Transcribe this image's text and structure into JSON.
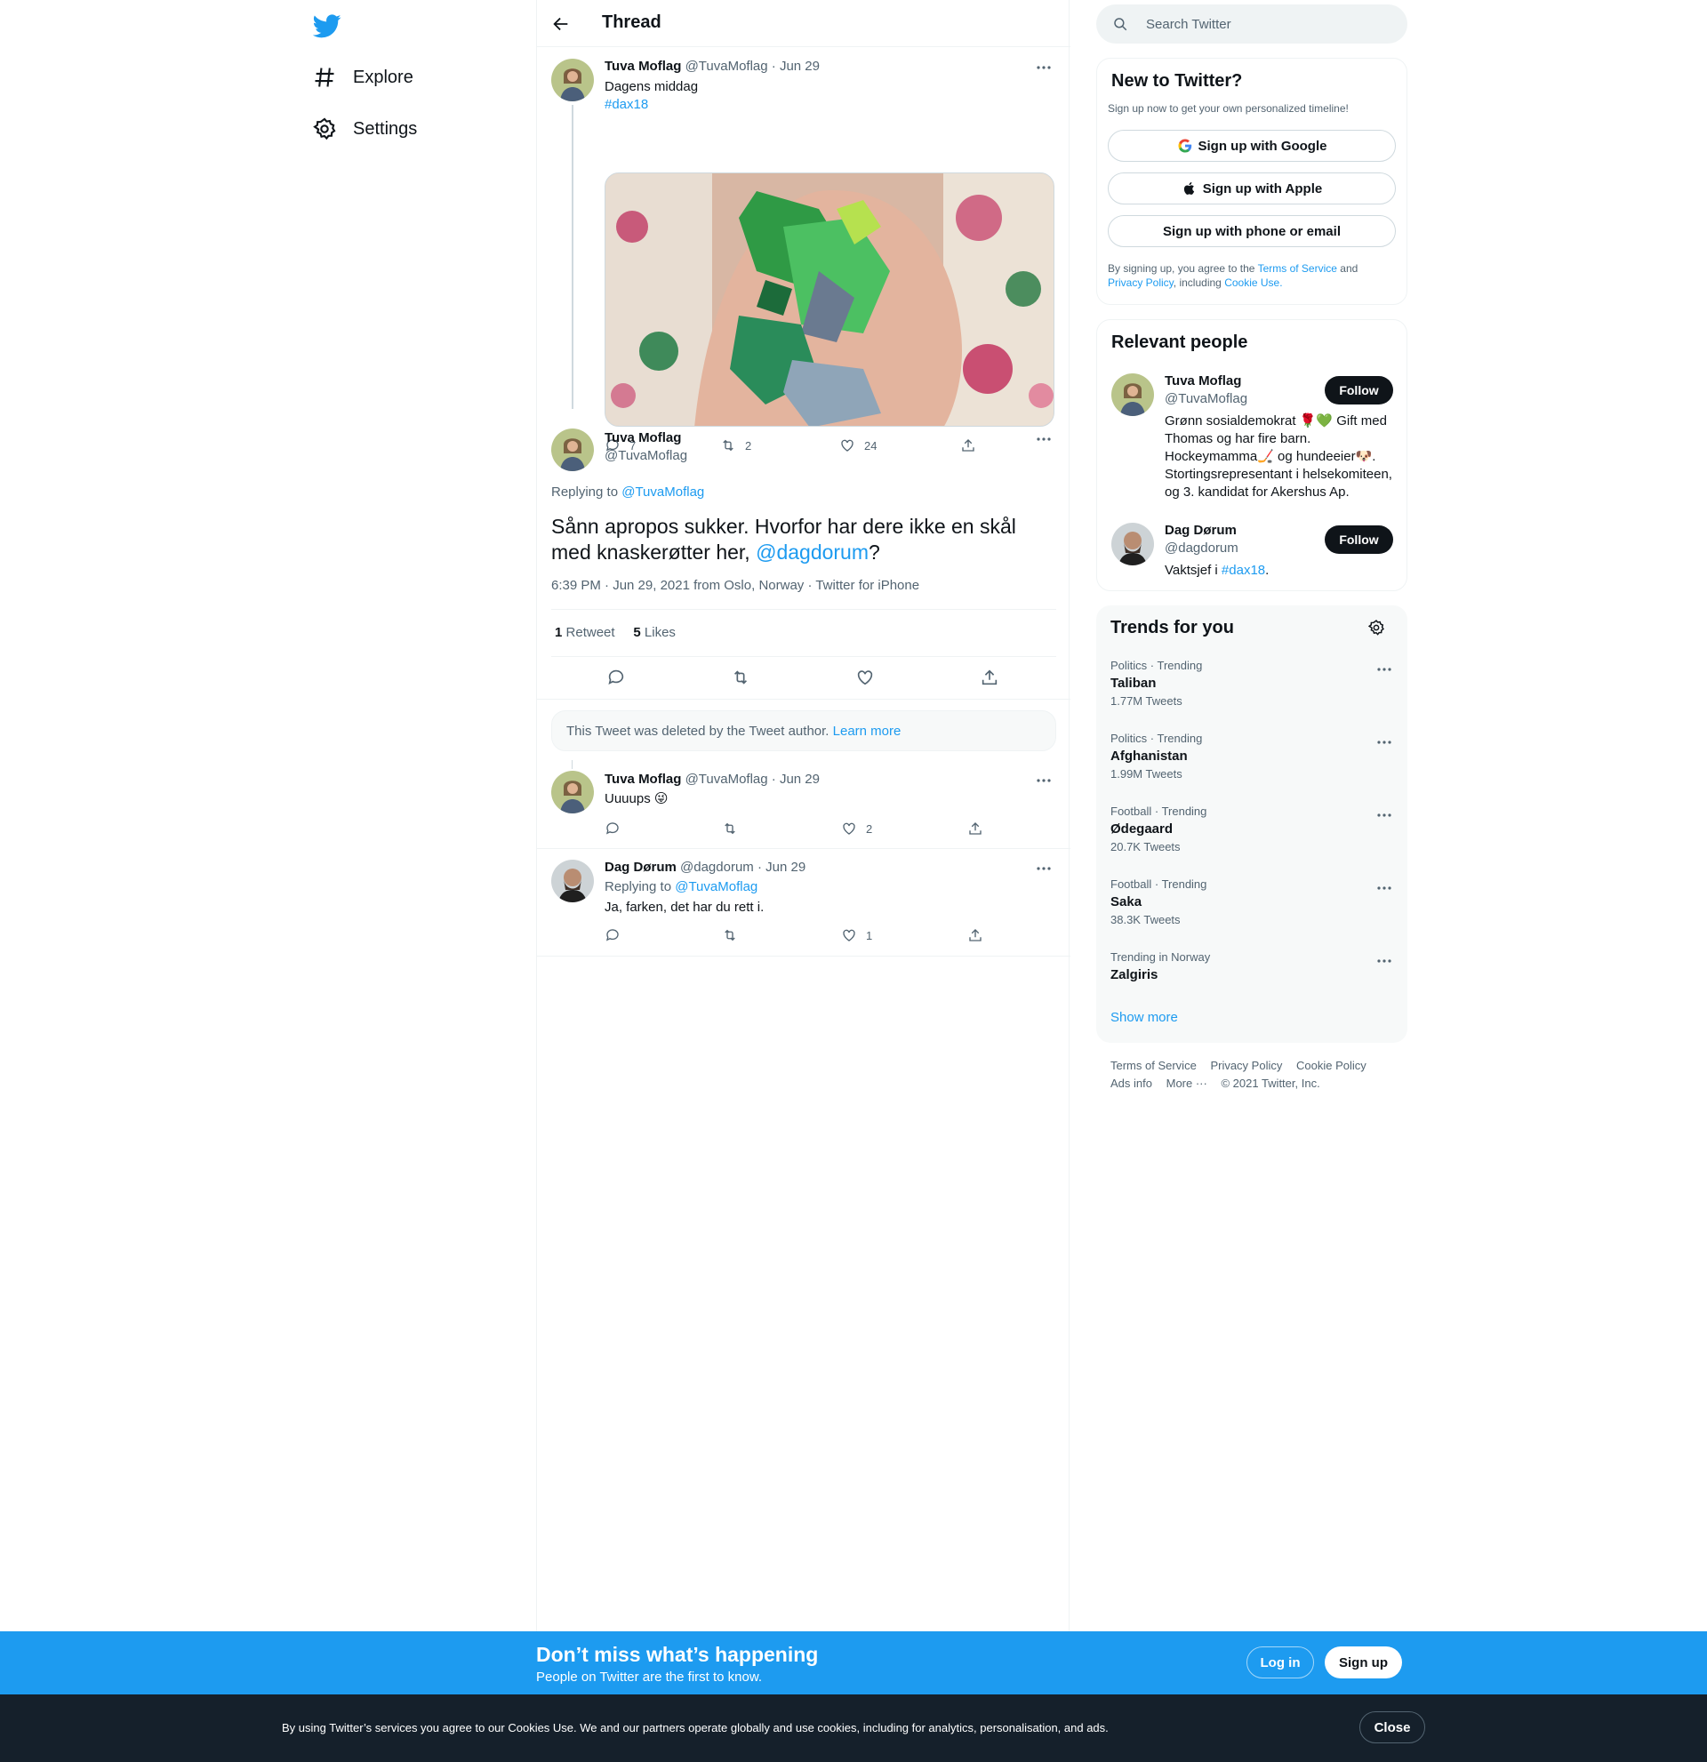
{
  "nav": {
    "items": [
      {
        "label": "Explore"
      },
      {
        "label": "Settings"
      }
    ]
  },
  "header": {
    "title": "Thread"
  },
  "tweets": {
    "t1": {
      "name": "Tuva Moflag",
      "handle": "@TuvaMoflag",
      "date": "· Jun 29",
      "text": "Dagens middag",
      "hashtag": "#dax18",
      "replies": "7",
      "retweets": "2",
      "likes": "24"
    },
    "main": {
      "name": "Tuva Moflag",
      "handle": "@TuvaMoflag",
      "replying_prefix": "Replying to",
      "replying_to": "@TuvaMoflag",
      "text_before": "Sånn apropos sukker. Hvorfor har dere ikke en skål med knaskerøtter her,",
      "mention": "@dagdorum",
      "text_after": "?",
      "meta": "6:39 PM · Jun 29, 2021 from Oslo, Norway · Twitter for iPhone",
      "retweet_count": "1",
      "retweet_label": "Retweet",
      "like_count": "5",
      "like_label": "Likes"
    },
    "deleted": {
      "text": "This Tweet was deleted by the Tweet author.",
      "link": "Learn more"
    },
    "t3": {
      "name": "Tuva Moflag",
      "handle": "@TuvaMoflag",
      "date": "· Jun 29",
      "text": "Uuuups 😜",
      "replies": "",
      "retweets": "",
      "likes": "2"
    },
    "t4": {
      "name": "Dag Dørum",
      "handle": "@dagdorum",
      "date": "· Jun 29",
      "replying_prefix": "Replying to",
      "replying_to": "@TuvaMoflag",
      "text": "Ja, farken, det har du rett i.",
      "replies": "",
      "retweets": "",
      "likes": "1"
    }
  },
  "search": {
    "placeholder": "Search Twitter"
  },
  "signup": {
    "title": "New to Twitter?",
    "subtitle": "Sign up now to get your own personalized timeline!",
    "google": "Sign up with Google",
    "apple": "Sign up with Apple",
    "phone": "Sign up with phone or email",
    "legal_1": "By signing up, you agree to the",
    "terms": "Terms of Service",
    "and": "and",
    "privacy": "Privacy Policy",
    "including": ", including",
    "cookie": "Cookie Use."
  },
  "relevant": {
    "title": "Relevant people",
    "people": [
      {
        "name": "Tuva Moflag",
        "handle": "@TuvaMoflag",
        "follow": "Follow",
        "bio": "Grønn sosialdemokrat 🌹💚 Gift med Thomas og har fire barn. Hockeymamma🏒 og hundeeier🐶. Stortingsrepresentant i helsekomiteen, og 3. kandidat for Akershus Ap."
      },
      {
        "name": "Dag Dørum",
        "handle": "@dagdorum",
        "follow": "Follow",
        "bio_prefix": "Vaktsjef i",
        "bio_tag": "#dax18",
        "bio_suffix": "."
      }
    ]
  },
  "trends": {
    "title": "Trends for you",
    "items": [
      {
        "context": "Politics · Trending",
        "name": "Taliban",
        "count": "1.77M Tweets"
      },
      {
        "context": "Politics · Trending",
        "name": "Afghanistan",
        "count": "1.99M Tweets"
      },
      {
        "context": "Football · Trending",
        "name": "Ødegaard",
        "count": "20.7K Tweets"
      },
      {
        "context": "Football · Trending",
        "name": "Saka",
        "count": "38.3K Tweets"
      },
      {
        "context": "Trending in Norway",
        "name": "Zalgiris",
        "count": ""
      }
    ],
    "show_more": "Show more"
  },
  "footer": {
    "links": [
      "Terms of Service",
      "Privacy Policy",
      "Cookie Policy",
      "Ads info",
      "More ···",
      "© 2021 Twitter, Inc."
    ]
  },
  "bottom_bar": {
    "title": "Don’t miss what’s happening",
    "subtitle": "People on Twitter are the first to know.",
    "login": "Log in",
    "signup": "Sign up"
  },
  "cookie_bar": {
    "text": "By using Twitter’s services you agree to our Cookies Use. We and our partners operate globally and use cookies, including for analytics, personalisation, and ads.",
    "close": "Close"
  },
  "colors": {
    "accent": "#1d9bf0",
    "text": "#0f1419",
    "muted": "#536471",
    "dark_bar": "#15202b"
  }
}
